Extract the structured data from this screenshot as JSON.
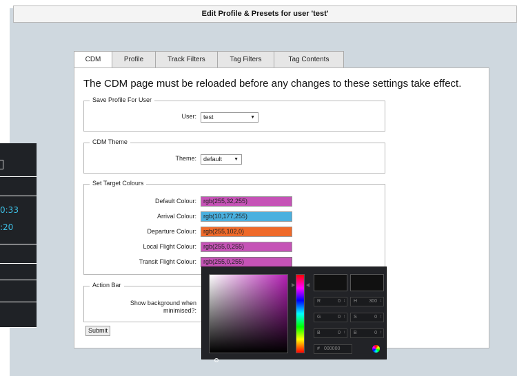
{
  "title": "Edit Profile & Presets for user 'test'",
  "left_panel": {
    "times": [
      "0:33",
      ":20"
    ]
  },
  "tabs": [
    {
      "label": "CDM",
      "active": true
    },
    {
      "label": "Profile",
      "active": false
    },
    {
      "label": "Track Filters",
      "active": false
    },
    {
      "label": "Tag Filters",
      "active": false
    },
    {
      "label": "Tag Contents",
      "active": false
    }
  ],
  "notice": "The CDM page must be reloaded before any changes to these settings take effect.",
  "save_profile": {
    "legend": "Save Profile For User",
    "user_label": "User:",
    "user_value": "test"
  },
  "cdm_theme": {
    "legend": "CDM Theme",
    "theme_label": "Theme:",
    "theme_value": "default"
  },
  "target_colours": {
    "legend": "Set Target Colours",
    "rows": [
      {
        "label": "Default Colour:",
        "value": "rgb(255,32,255)",
        "color": "#c553b6"
      },
      {
        "label": "Arrival Colour:",
        "value": "rgb(10,177,255)",
        "color": "#4ab0df"
      },
      {
        "label": "Departure Colour:",
        "value": "rgb(255,102,0)",
        "color": "#ef6a2a"
      },
      {
        "label": "Local Flight Colour:",
        "value": "rgb(255,0,255)",
        "color": "#c553b6"
      },
      {
        "label": "Transit Flight Colour:",
        "value": "rgb(255,0,255)",
        "color": "#c553b6"
      }
    ]
  },
  "action_bar": {
    "legend": "Action Bar",
    "label_line1": "Show background when",
    "label_line2": "minimised?:"
  },
  "submit_label": "Submit",
  "picker": {
    "r_label": "R",
    "r_value": "0",
    "g_label": "G",
    "g_value": "0",
    "b_label": "B",
    "b_value": "0",
    "h_label": "H",
    "h_value": "300",
    "s_label": "S",
    "s_value": "0",
    "br_label": "B",
    "br_value": "0",
    "hex_label": "#",
    "hex_value": "000000"
  }
}
